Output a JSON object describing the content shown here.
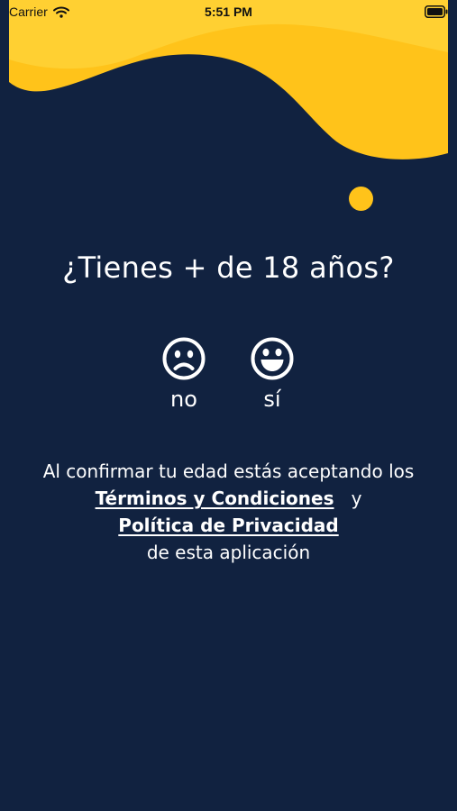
{
  "status_bar": {
    "carrier": "Carrier",
    "time": "5:51 PM"
  },
  "question": "¿Tienes + de 18 años?",
  "choices": [
    {
      "label": "no",
      "icon": "sad-face-icon"
    },
    {
      "label": "sí",
      "icon": "happy-face-icon"
    }
  ],
  "terms": {
    "intro": "Al confirmar tu edad estás aceptando los",
    "terms_link": "Términos y Condiciones",
    "connector": "y",
    "privacy_link": "Política de Privacidad",
    "outro": "de esta aplicación"
  },
  "colors": {
    "background": "#112240",
    "accent": "#ffc31a",
    "accent_light": "#ffd032",
    "text": "#ffffff"
  }
}
